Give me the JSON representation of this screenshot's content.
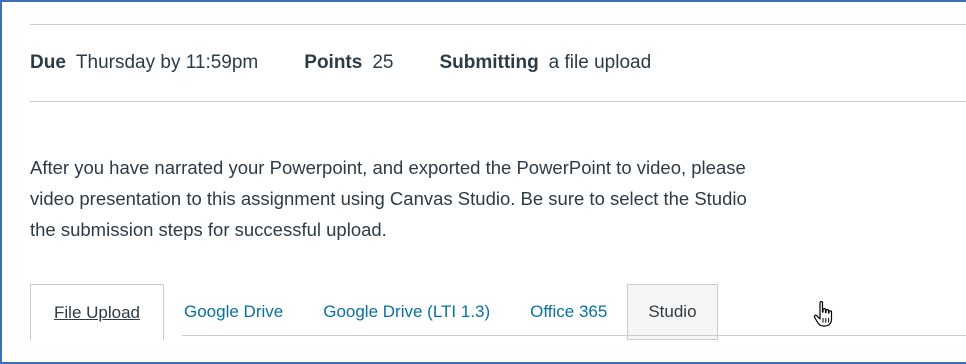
{
  "assignment": {
    "meta": {
      "due_label": "Due",
      "due_value": "Thursday by 11:59pm",
      "points_label": "Points",
      "points_value": "25",
      "submitting_label": "Submitting",
      "submitting_value": "a file upload"
    },
    "description": {
      "line1": "After you have narrated your Powerpoint, and exported the PowerPoint to video, please",
      "line2": "video presentation to this assignment using Canvas Studio.  Be sure to select the Studio",
      "line3": "the submission steps for successful upload."
    }
  },
  "submission_tabs": [
    {
      "label": "File Upload",
      "state": "active"
    },
    {
      "label": "Google Drive",
      "state": "default"
    },
    {
      "label": "Google Drive (LTI 1.3)",
      "state": "default"
    },
    {
      "label": "Office 365",
      "state": "default"
    },
    {
      "label": "Studio",
      "state": "hovered"
    }
  ],
  "colors": {
    "link": "#0770a3",
    "text": "#2d3b45",
    "border": "#c7cdd1",
    "frame": "#3f6fb4"
  },
  "icons": {
    "cursor": "hand-pointer-icon"
  }
}
